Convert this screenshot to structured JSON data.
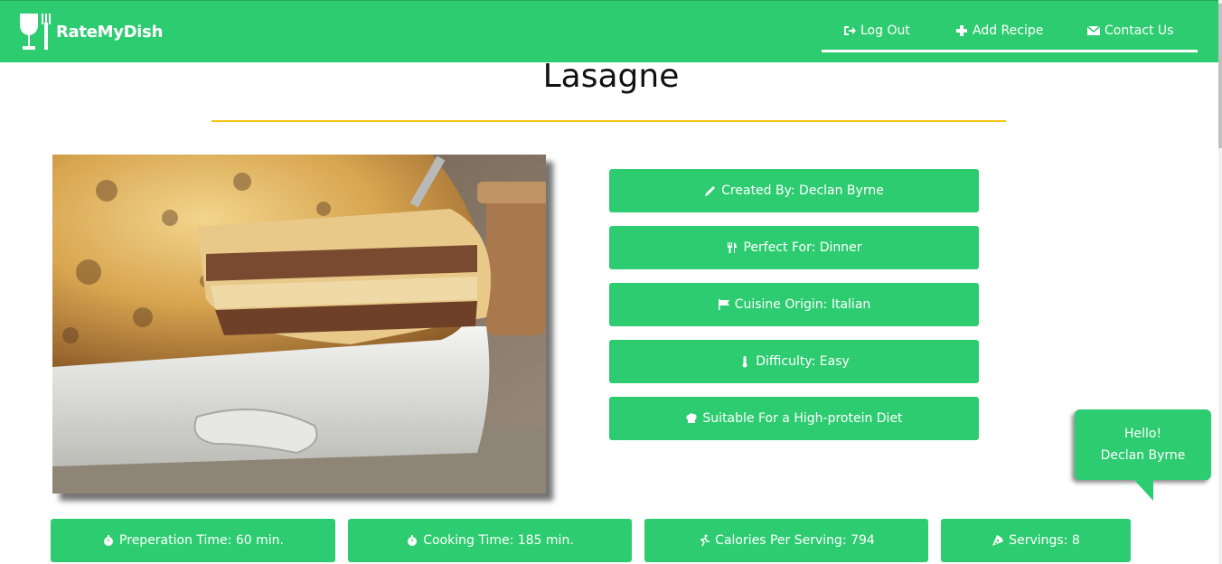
{
  "brand": {
    "name": "RateMyDish"
  },
  "nav": {
    "logout_label": "Log Out",
    "add_recipe_label": "Add Recipe",
    "contact_label": "Contact Us"
  },
  "recipe": {
    "title": "Lasagne",
    "details": {
      "created_by": "Created By: Declan Byrne",
      "perfect_for": "Perfect For: Dinner",
      "cuisine": "Cuisine Origin: Italian",
      "difficulty": "Difficulty: Easy",
      "diet": "Suitable For a High-protein Diet"
    },
    "stats": {
      "prep": "Preperation Time: 60 min.",
      "cooking": "Cooking Time: 185 min.",
      "calories": "Calories Per Serving: 794",
      "servings": "Servings: 8"
    }
  },
  "greeting": {
    "line1": "Hello!",
    "line2": "Declan Byrne"
  },
  "colors": {
    "accent": "#2ecc71",
    "rule": "#f1c40f"
  },
  "icons": [
    "logout-icon",
    "plus-icon",
    "envelope-icon",
    "pencil-icon",
    "cutlery-icon",
    "flag-icon",
    "thermometer-icon",
    "chef-hat-icon",
    "stopwatch-icon",
    "running-icon",
    "pizza-icon"
  ]
}
